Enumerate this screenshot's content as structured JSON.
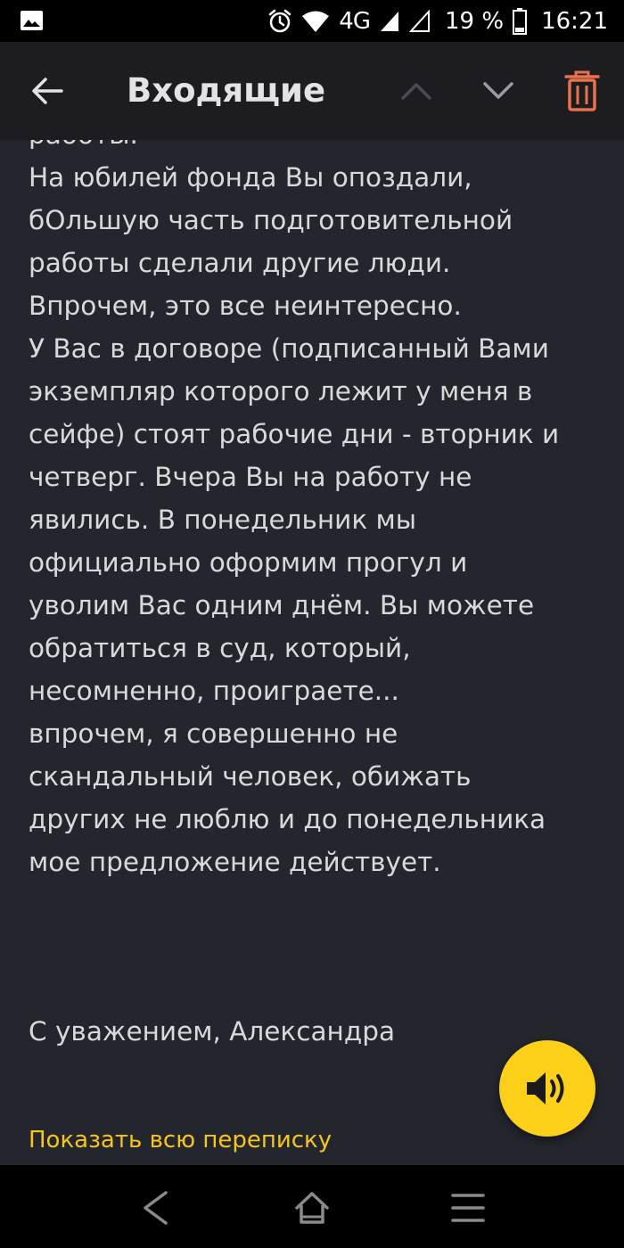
{
  "status_bar": {
    "network_label": "4G",
    "battery_text": "19 %",
    "time": "16:21",
    "icons": [
      "gallery-icon",
      "alarm-icon",
      "wifi-icon",
      "signal-icon",
      "signal-empty-icon",
      "battery-icon"
    ]
  },
  "toolbar": {
    "title": "Входящие",
    "icons": [
      "back-arrow-icon",
      "chevron-up-icon",
      "chevron-down-icon",
      "trash-icon"
    ],
    "accent_color": "#e8734a"
  },
  "message": {
    "lines": [
      "работы.",
      "На юбилей фонда Вы опоздали,",
      "бОльшую часть подготовительной",
      "работы сделали другие люди.",
      "Впрочем, это все неинтересно.",
      "У Вас в договоре (подписанный Вами",
      "экземпляр которого лежит у меня в",
      "сейфе) стоят рабочие дни - вторник и",
      "четверг. Вчера Вы на работу не",
      "явились. В понедельник мы",
      "официально оформим прогул и",
      "уволим Вас одним днём. Вы можете",
      "обратиться в суд, который,",
      "несомненно, проиграете...",
      "впрочем, я совершенно не",
      "скандальный человек, обижать",
      "других не люблю и до понедельника",
      "мое предложение действует."
    ],
    "signature": "С уважением, Александра",
    "show_thread_label": "Показать всю переписку",
    "link_color": "#f5c518"
  },
  "fab": {
    "icon": "speaker-icon",
    "color": "#fcd019"
  },
  "system_nav": {
    "icons": [
      "nav-back-icon",
      "nav-home-icon",
      "nav-menu-icon"
    ]
  }
}
